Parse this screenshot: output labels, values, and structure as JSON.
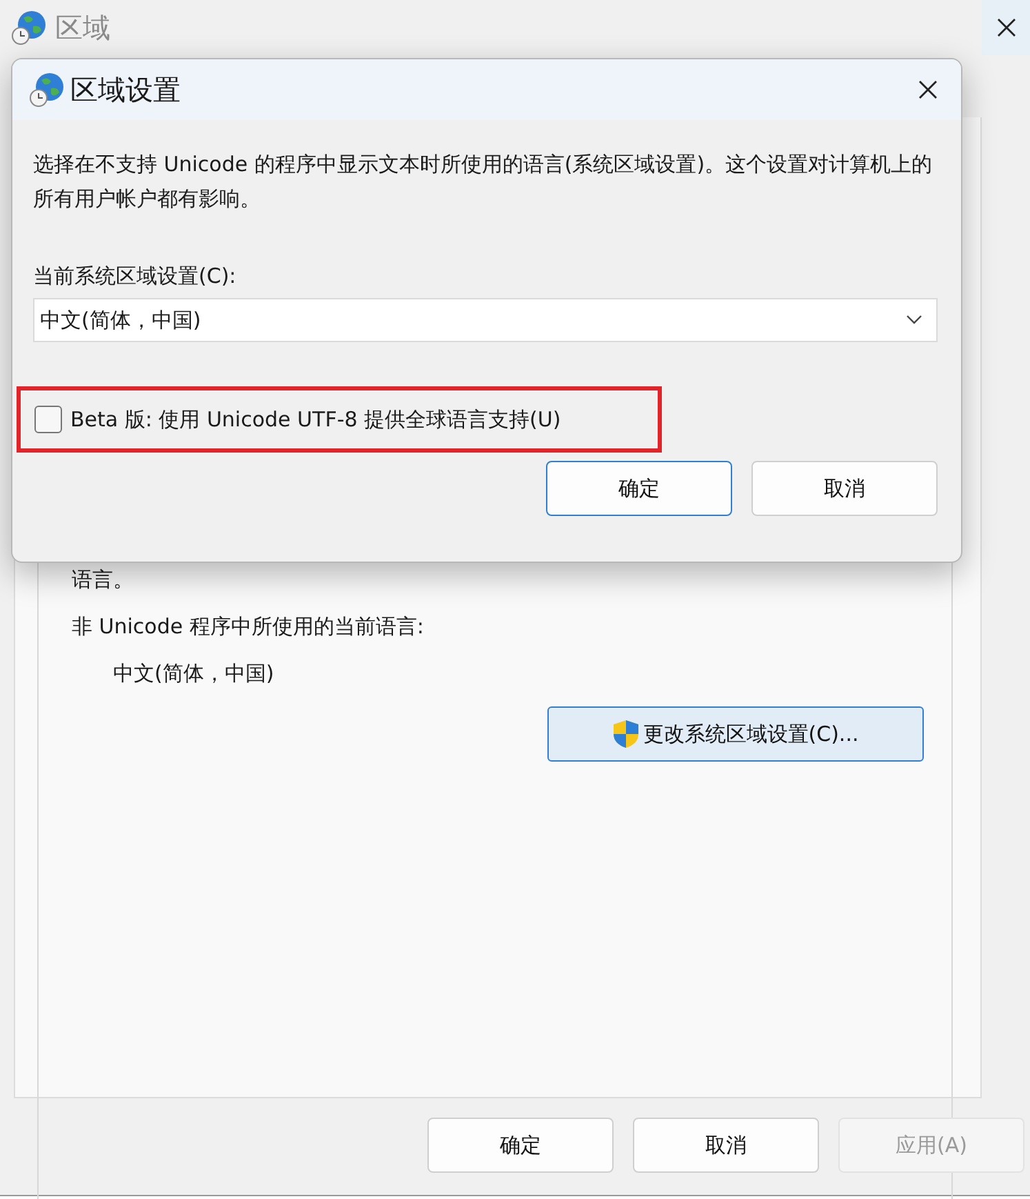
{
  "main_window": {
    "title": "区域",
    "active": false,
    "group": {
      "partial_text": "语言。",
      "label": "非 Unicode 程序中所使用的当前语言:",
      "current_language": "中文(简体，中国)",
      "change_button": "更改系统区域设置(C)..."
    },
    "buttons": [
      {
        "label": "确定",
        "disabled": false
      },
      {
        "label": "取消",
        "disabled": false
      },
      {
        "label": "应用(A)",
        "disabled": true
      }
    ]
  },
  "dialog": {
    "title": "区域设置",
    "description": "选择在不支持 Unicode 的程序中显示文本时所使用的语言(系统区域设置)。这个设置对计算机上的所有用户帐户都有影响。",
    "locale_label": "当前系统区域设置(C):",
    "locale_select": {
      "value": "中文(简体，中国)"
    },
    "beta_checkbox": {
      "label": "Beta 版: 使用 Unicode UTF-8 提供全球语言支持(U)",
      "checked": false,
      "highlighted": true
    },
    "buttons": [
      {
        "label": "确定",
        "default": true
      },
      {
        "label": "取消",
        "default": false
      }
    ]
  }
}
